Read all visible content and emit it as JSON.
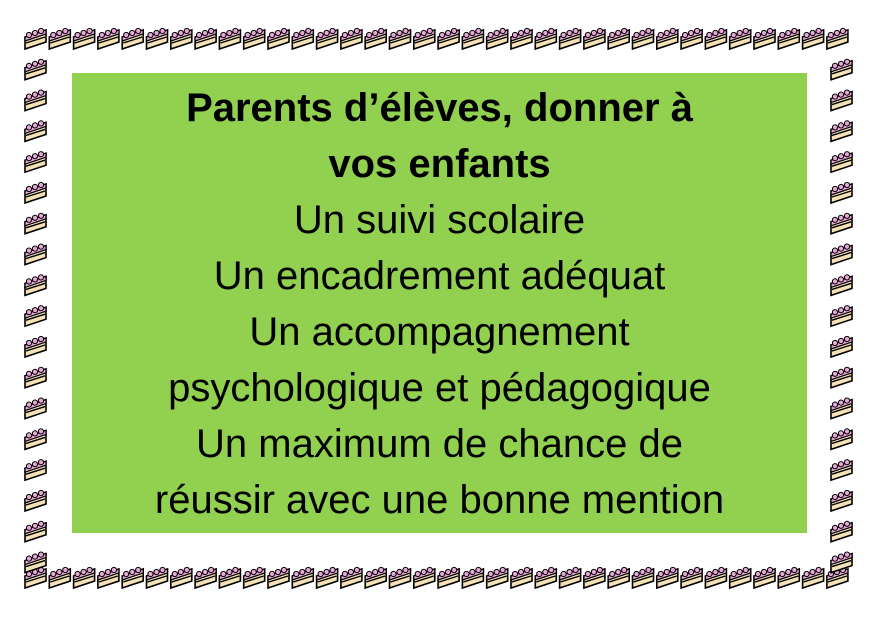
{
  "notice": {
    "heading_lines": [
      "Parents d’élèves, donner à",
      "vos enfants"
    ],
    "body_lines": [
      "Un suivi scolaire",
      "Un encadrement adéquat",
      "Un accompagnement",
      "psychologique et pédagogique",
      "Un maximum de chance de",
      "réussir avec une bonne mention"
    ]
  },
  "colors": {
    "panel_background": "#92d050",
    "text": "#000000",
    "border_cake_icing": "#e8a8d8",
    "border_cake_body": "#f4e2b6"
  },
  "border": {
    "icon": "cake-slice-icon"
  }
}
